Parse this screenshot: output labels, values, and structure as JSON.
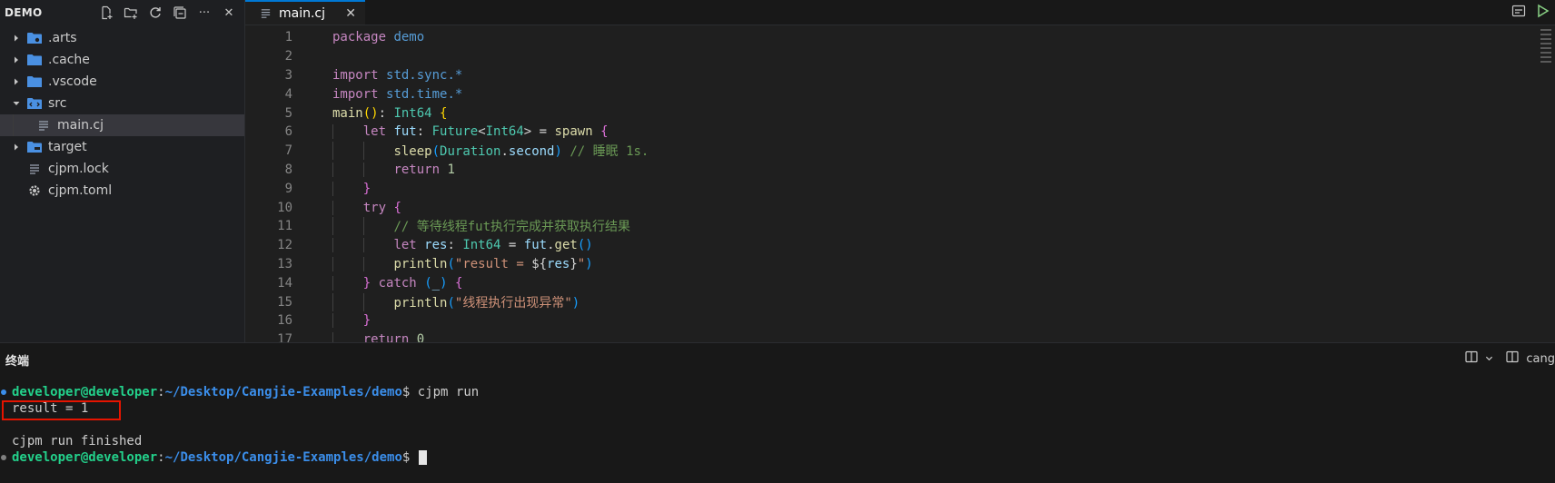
{
  "explorer": {
    "title": "DEMO",
    "actions": [
      "new-file-icon",
      "new-folder-icon",
      "refresh-icon",
      "collapse-all-icon",
      "more-icon",
      "close-icon"
    ],
    "more_glyph": "···",
    "close_glyph": "✕",
    "items": [
      {
        "label": ".arts",
        "type": "folder",
        "expanded": false,
        "icon": "folder-icon"
      },
      {
        "label": ".cache",
        "type": "folder",
        "expanded": false,
        "icon": "folder-icon"
      },
      {
        "label": ".vscode",
        "type": "folder",
        "expanded": false,
        "icon": "folder-icon"
      },
      {
        "label": "src",
        "type": "folder",
        "expanded": true,
        "icon": "folder-src-icon"
      },
      {
        "label": "main.cj",
        "type": "file",
        "selected": true,
        "icon": "file-lines-icon"
      },
      {
        "label": "target",
        "type": "folder",
        "expanded": false,
        "icon": "folder-icon"
      },
      {
        "label": "cjpm.lock",
        "type": "file",
        "icon": "file-lines-icon"
      },
      {
        "label": "cjpm.toml",
        "type": "file",
        "icon": "gear-icon"
      }
    ]
  },
  "editor": {
    "tab": {
      "label": "main.cj",
      "close_glyph": "✕"
    },
    "lines": [
      {
        "n": "1",
        "indent": 0,
        "tokens": [
          [
            "kw",
            "package"
          ],
          [
            "op",
            " "
          ],
          [
            "ns",
            "demo"
          ]
        ]
      },
      {
        "n": "2",
        "indent": 0,
        "tokens": []
      },
      {
        "n": "3",
        "indent": 0,
        "tokens": [
          [
            "kw",
            "import"
          ],
          [
            "op",
            " "
          ],
          [
            "ns",
            "std.sync.*"
          ]
        ]
      },
      {
        "n": "4",
        "indent": 0,
        "tokens": [
          [
            "kw",
            "import"
          ],
          [
            "op",
            " "
          ],
          [
            "ns",
            "std.time.*"
          ]
        ]
      },
      {
        "n": "5",
        "indent": 0,
        "tokens": [
          [
            "fn",
            "main"
          ],
          [
            "p1",
            "()"
          ],
          [
            "op",
            ": "
          ],
          [
            "ty",
            "Int64"
          ],
          [
            "op",
            " "
          ],
          [
            "p1",
            "{"
          ]
        ]
      },
      {
        "n": "6",
        "indent": 1,
        "tokens": [
          [
            "kw",
            "let"
          ],
          [
            "op",
            " "
          ],
          [
            "id",
            "fut"
          ],
          [
            "op",
            ": "
          ],
          [
            "ty",
            "Future"
          ],
          [
            "op",
            "<"
          ],
          [
            "ty",
            "Int64"
          ],
          [
            "op",
            "> = "
          ],
          [
            "fn",
            "spawn"
          ],
          [
            "op",
            " "
          ],
          [
            "p2",
            "{"
          ]
        ]
      },
      {
        "n": "7",
        "indent": 2,
        "tokens": [
          [
            "fn",
            "sleep"
          ],
          [
            "p3",
            "("
          ],
          [
            "ty",
            "Duration"
          ],
          [
            "op",
            "."
          ],
          [
            "id",
            "second"
          ],
          [
            "p3",
            ")"
          ],
          [
            "op",
            " "
          ],
          [
            "cm",
            "// 睡眠 1s."
          ]
        ]
      },
      {
        "n": "8",
        "indent": 2,
        "tokens": [
          [
            "kw",
            "return"
          ],
          [
            "op",
            " "
          ],
          [
            "num",
            "1"
          ]
        ]
      },
      {
        "n": "9",
        "indent": 1,
        "tokens": [
          [
            "p2",
            "}"
          ]
        ]
      },
      {
        "n": "10",
        "indent": 1,
        "tokens": [
          [
            "kw",
            "try"
          ],
          [
            "op",
            " "
          ],
          [
            "p2",
            "{"
          ]
        ]
      },
      {
        "n": "11",
        "indent": 2,
        "tokens": [
          [
            "cm",
            "// 等待线程fut执行完成并获取执行结果"
          ]
        ]
      },
      {
        "n": "12",
        "indent": 2,
        "tokens": [
          [
            "kw",
            "let"
          ],
          [
            "op",
            " "
          ],
          [
            "id",
            "res"
          ],
          [
            "op",
            ": "
          ],
          [
            "ty",
            "Int64"
          ],
          [
            "op",
            " = "
          ],
          [
            "id",
            "fut"
          ],
          [
            "op",
            "."
          ],
          [
            "fn",
            "get"
          ],
          [
            "p3",
            "()"
          ]
        ]
      },
      {
        "n": "13",
        "indent": 2,
        "tokens": [
          [
            "fn",
            "println"
          ],
          [
            "p3",
            "("
          ],
          [
            "str",
            "\"result = "
          ],
          [
            "op",
            "${"
          ],
          [
            "id",
            "res"
          ],
          [
            "op",
            "}"
          ],
          [
            "str",
            "\""
          ],
          [
            "p3",
            ")"
          ]
        ]
      },
      {
        "n": "14",
        "indent": 1,
        "tokens": [
          [
            "p2",
            "}"
          ],
          [
            "op",
            " "
          ],
          [
            "kw",
            "catch"
          ],
          [
            "op",
            " "
          ],
          [
            "p3",
            "("
          ],
          [
            "id",
            "_"
          ],
          [
            "p3",
            ")"
          ],
          [
            "op",
            " "
          ],
          [
            "p2",
            "{"
          ]
        ]
      },
      {
        "n": "15",
        "indent": 2,
        "tokens": [
          [
            "fn",
            "println"
          ],
          [
            "p3",
            "("
          ],
          [
            "str",
            "\"线程执行出现异常\""
          ],
          [
            "p3",
            ")"
          ]
        ]
      },
      {
        "n": "16",
        "indent": 1,
        "tokens": [
          [
            "p2",
            "}"
          ]
        ]
      },
      {
        "n": "17",
        "indent": 1,
        "tokens": [
          [
            "kw",
            "return"
          ],
          [
            "op",
            " "
          ],
          [
            "num",
            "0"
          ]
        ]
      }
    ]
  },
  "terminal": {
    "title": "终端",
    "tab_label": "cang",
    "prompt_user": "developer@developer",
    "prompt_colon": ":",
    "prompt_path": "~/Desktop/Cangjie-Examples/demo",
    "prompt_suffix": "$ ",
    "command": "cjpm run",
    "output_result": "result = 1",
    "output_blank": "",
    "output_finished": "cjpm run finished",
    "dot_colors": {
      "first": "#3b8eea",
      "second": "#808080"
    }
  },
  "colors": {
    "accent": "#0078d4",
    "highlight_box": "#e51400"
  }
}
